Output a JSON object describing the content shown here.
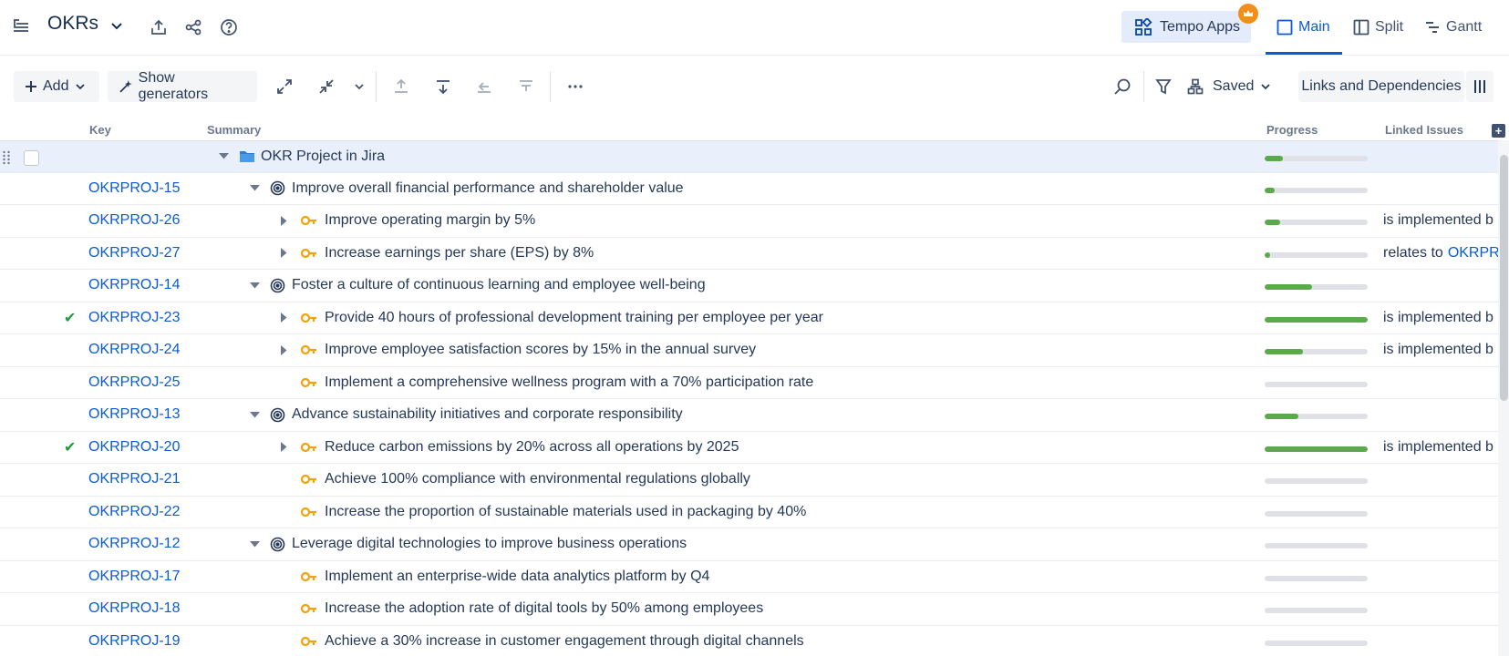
{
  "header": {
    "title": "OKRs",
    "tempo_apps_label": "Tempo Apps",
    "tabs": [
      {
        "label": "Main",
        "active": true
      },
      {
        "label": "Split",
        "active": false
      },
      {
        "label": "Gantt",
        "active": false
      }
    ]
  },
  "toolbar": {
    "add_label": "Add",
    "show_generators_label": "Show generators",
    "saved_label": "Saved",
    "links_label": "Links and Dependencies"
  },
  "columns": {
    "key": "Key",
    "summary": "Summary",
    "progress": "Progress",
    "linked": "Linked Issues"
  },
  "colors": {
    "accent": "#0b5bd6",
    "progress_fill": "#5aa94a",
    "progress_track": "#dfe1e6",
    "key_result_icon": "#f0a30a",
    "done_check": "#1f9a3f"
  },
  "rows": [
    {
      "key": "",
      "summary": "OKR Project in Jira",
      "type": "project",
      "level": 0,
      "expanded": true,
      "progress": 0.18,
      "linked_text": "",
      "linked_key": "",
      "done": false
    },
    {
      "key": "OKRPROJ-15",
      "summary": "Improve overall financial performance and shareholder value",
      "type": "objective",
      "level": 1,
      "expanded": true,
      "progress": 0.1,
      "linked_text": "",
      "linked_key": "",
      "done": false
    },
    {
      "key": "OKRPROJ-26",
      "summary": "Improve operating margin by 5%",
      "type": "key-result",
      "level": 2,
      "expandable": true,
      "progress": 0.15,
      "linked_text": "is implemented b",
      "linked_key": "",
      "done": false
    },
    {
      "key": "OKRPROJ-27",
      "summary": "Increase earnings per share (EPS) by 8%",
      "type": "key-result",
      "level": 2,
      "expandable": true,
      "progress": 0.05,
      "linked_text": "relates to",
      "linked_key": "OKRPR",
      "done": false
    },
    {
      "key": "OKRPROJ-14",
      "summary": "Foster a culture of continuous learning and employee well-being",
      "type": "objective",
      "level": 1,
      "expanded": true,
      "progress": 0.46,
      "linked_text": "",
      "linked_key": "",
      "done": false
    },
    {
      "key": "OKRPROJ-23",
      "summary": "Provide 40 hours of professional development training per employee per year",
      "type": "key-result",
      "level": 2,
      "expandable": true,
      "progress": 1.0,
      "linked_text": "is implemented b",
      "linked_key": "",
      "done": true
    },
    {
      "key": "OKRPROJ-24",
      "summary": "Improve employee satisfaction scores by 15% in the annual survey",
      "type": "key-result",
      "level": 2,
      "expandable": true,
      "progress": 0.37,
      "linked_text": "is implemented b",
      "linked_key": "",
      "done": false
    },
    {
      "key": "OKRPROJ-25",
      "summary": "Implement a comprehensive wellness program with a 70% participation rate",
      "type": "key-result",
      "level": 2,
      "expandable": false,
      "progress": 0.0,
      "linked_text": "",
      "linked_key": "",
      "done": false
    },
    {
      "key": "OKRPROJ-13",
      "summary": "Advance sustainability initiatives and corporate responsibility",
      "type": "objective",
      "level": 1,
      "expanded": true,
      "progress": 0.33,
      "linked_text": "",
      "linked_key": "",
      "done": false
    },
    {
      "key": "OKRPROJ-20",
      "summary": "Reduce carbon emissions by 20% across all operations by 2025",
      "type": "key-result",
      "level": 2,
      "expandable": true,
      "progress": 1.0,
      "linked_text": "is implemented b",
      "linked_key": "",
      "done": true
    },
    {
      "key": "OKRPROJ-21",
      "summary": "Achieve 100% compliance with environmental regulations globally",
      "type": "key-result",
      "level": 2,
      "expandable": false,
      "progress": 0.0,
      "linked_text": "",
      "linked_key": "",
      "done": false
    },
    {
      "key": "OKRPROJ-22",
      "summary": "Increase the proportion of sustainable materials used in packaging by 40%",
      "type": "key-result",
      "level": 2,
      "expandable": false,
      "progress": 0.0,
      "linked_text": "",
      "linked_key": "",
      "done": false
    },
    {
      "key": "OKRPROJ-12",
      "summary": "Leverage digital technologies to improve business operations",
      "type": "objective",
      "level": 1,
      "expanded": true,
      "progress": 0.0,
      "linked_text": "",
      "linked_key": "",
      "done": false
    },
    {
      "key": "OKRPROJ-17",
      "summary": "Implement an enterprise-wide data analytics platform by Q4",
      "type": "key-result",
      "level": 2,
      "expandable": false,
      "progress": 0.0,
      "linked_text": "",
      "linked_key": "",
      "done": false
    },
    {
      "key": "OKRPROJ-18",
      "summary": "Increase the adoption rate of digital tools by 50% among employees",
      "type": "key-result",
      "level": 2,
      "expandable": false,
      "progress": 0.0,
      "linked_text": "",
      "linked_key": "",
      "done": false
    },
    {
      "key": "OKRPROJ-19",
      "summary": "Achieve a 30% increase in customer engagement through digital channels",
      "type": "key-result",
      "level": 2,
      "expandable": false,
      "progress": 0.0,
      "linked_text": "",
      "linked_key": "",
      "done": false
    }
  ]
}
